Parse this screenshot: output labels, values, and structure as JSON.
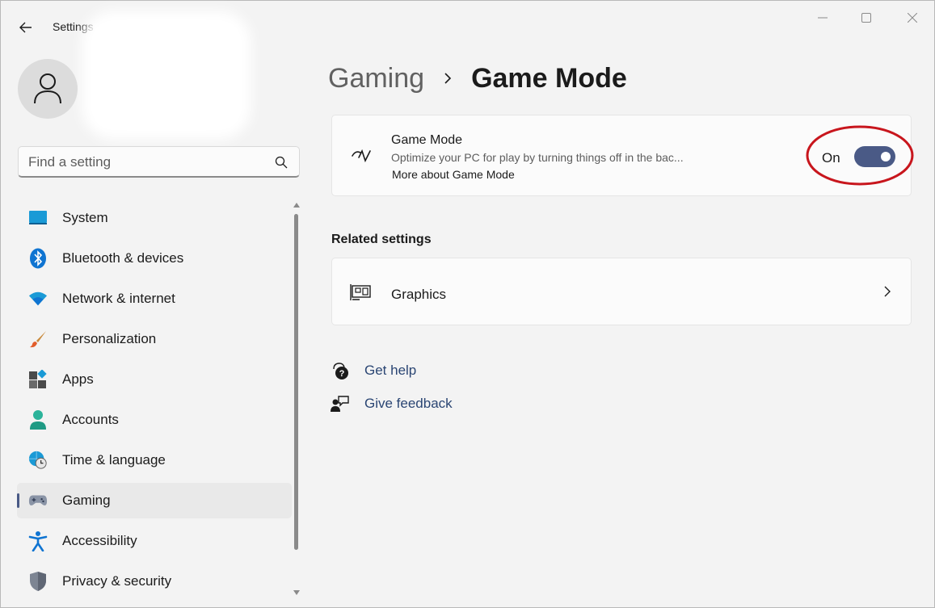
{
  "window": {
    "title": "Settings"
  },
  "user": {
    "avatar_icon": "person-icon"
  },
  "search": {
    "placeholder": "Find a setting",
    "icon": "search-icon"
  },
  "sidebar": {
    "items": [
      {
        "label": "System",
        "icon": "system-icon"
      },
      {
        "label": "Bluetooth & devices",
        "icon": "bluetooth-icon"
      },
      {
        "label": "Network & internet",
        "icon": "wifi-icon"
      },
      {
        "label": "Personalization",
        "icon": "brush-icon"
      },
      {
        "label": "Apps",
        "icon": "apps-icon"
      },
      {
        "label": "Accounts",
        "icon": "accounts-icon"
      },
      {
        "label": "Time & language",
        "icon": "globe-clock-icon"
      },
      {
        "label": "Gaming",
        "icon": "gamepad-icon",
        "active": true
      },
      {
        "label": "Accessibility",
        "icon": "accessibility-icon"
      },
      {
        "label": "Privacy & security",
        "icon": "shield-icon"
      }
    ]
  },
  "breadcrumb": {
    "parent": "Gaming",
    "current": "Game Mode"
  },
  "game_mode": {
    "title": "Game Mode",
    "description": "Optimize your PC for play by turning things off in the bac...",
    "link": "More about Game Mode",
    "toggle_label": "On",
    "toggle_on": true
  },
  "related": {
    "title": "Related settings",
    "graphics_label": "Graphics"
  },
  "help": {
    "get_help": "Get help",
    "give_feedback": "Give feedback"
  },
  "colors": {
    "accent": "#4a5a86",
    "annotation": "#c8161d",
    "background": "#f3f3f3"
  }
}
